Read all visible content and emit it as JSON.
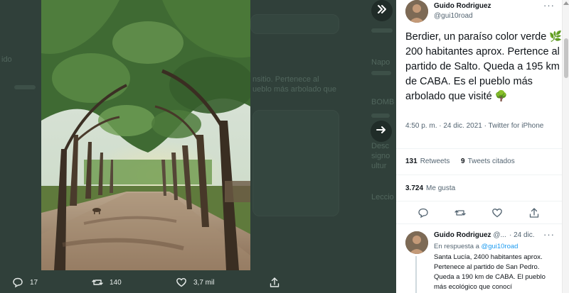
{
  "background": {
    "snippets": [
      "ido",
      "Napo",
      "nsitio. Pertenece al",
      "ueblo más arbolado que",
      "BOMB",
      "Desc",
      "signo",
      "ultur",
      "Leccio"
    ]
  },
  "media": {
    "alt": "Camino de tierra bajo un túnel de árboles"
  },
  "media_actions": {
    "reply_count": "17",
    "retweet_count": "140",
    "like_count": "3,7 mil"
  },
  "tweet": {
    "author_name": "Guido Rodriguez",
    "author_handle": "@gui10road",
    "text": "Berdier, un paraíso color verde 🌿 200 habitantes aprox. Pertence al partido de Salto. Queda a 195 km de CABA. Es el pueblo más arbolado que visité 🌳",
    "time": "4:50 p. m. · 24 dic. 2021 · Twitter for iPhone",
    "retweets_count": "131",
    "retweets_label": "Retweets",
    "quotes_count": "9",
    "quotes_label": "Tweets citados",
    "likes_count": "3.724",
    "likes_label": "Me gusta"
  },
  "reply": {
    "author_name": "Guido Rodriguez",
    "handle_truncated": "@...",
    "date": "· 24 dic.",
    "in_reply_label": "En respuesta a",
    "in_reply_handle": "@gui10road",
    "text": "Santa Lucía, 2400 habitantes aprox. Pertenece al partido de San Pedro. Queda a 190 km de CABA. El pueblo más ecológico que conocí"
  },
  "icons": {
    "collapse": "double-chevron-right-icon",
    "next": "arrow-right-icon",
    "more": "more-dots-icon"
  },
  "colors": {
    "accent": "#1d9bf0",
    "overlay": "#30403a",
    "panel": "#ffffff"
  }
}
